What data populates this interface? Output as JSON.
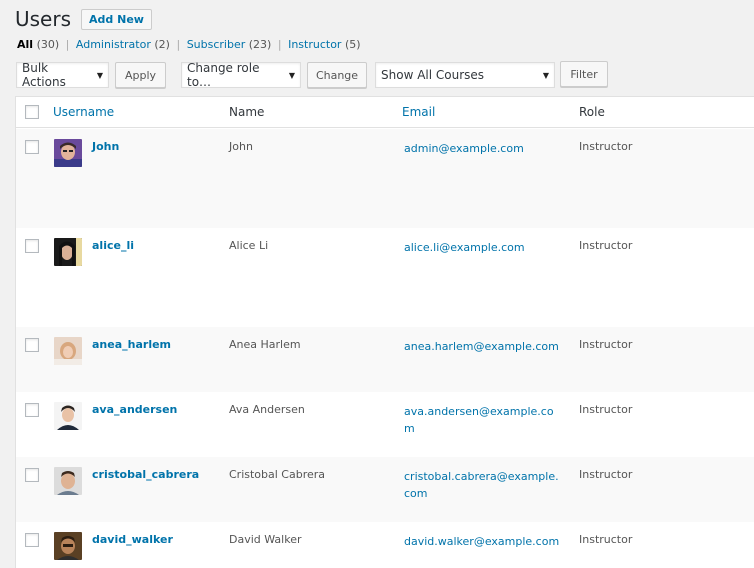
{
  "header": {
    "title": "Users",
    "add_new": "Add New"
  },
  "filters": {
    "all": {
      "label": "All",
      "count": "(30)"
    },
    "administrator": {
      "label": "Administrator",
      "count": "(2)"
    },
    "subscriber": {
      "label": "Subscriber",
      "count": "(23)"
    },
    "instructor": {
      "label": "Instructor",
      "count": "(5)"
    },
    "separator": "|"
  },
  "toolbar": {
    "bulk_actions": "Bulk Actions",
    "apply": "Apply",
    "change_role": "Change role to…",
    "change": "Change",
    "courses": "Show All Courses",
    "filter": "Filter",
    "caret": "▼"
  },
  "columns": {
    "username": "Username",
    "name": "Name",
    "email": "Email",
    "role": "Role"
  },
  "users": [
    {
      "username": "John",
      "name": "John",
      "email": "admin@example.com",
      "role": "Instructor"
    },
    {
      "username": "alice_li",
      "name": "Alice Li",
      "email": "alice.li@example.com",
      "role": "Instructor"
    },
    {
      "username": "anea_harlem",
      "name": "Anea Harlem",
      "email": "anea.harlem@example.com",
      "role": "Instructor"
    },
    {
      "username": "ava_andersen",
      "name": "Ava Andersen",
      "email": "ava.andersen@example.com",
      "role": "Instructor"
    },
    {
      "username": "cristobal_cabrera",
      "name": "Cristobal Cabrera",
      "email": "cristobal.cabrera@example.com",
      "role": "Instructor"
    },
    {
      "username": "david_walker",
      "name": "David Walker",
      "email": "david.walker@example.com",
      "role": "Instructor"
    }
  ]
}
